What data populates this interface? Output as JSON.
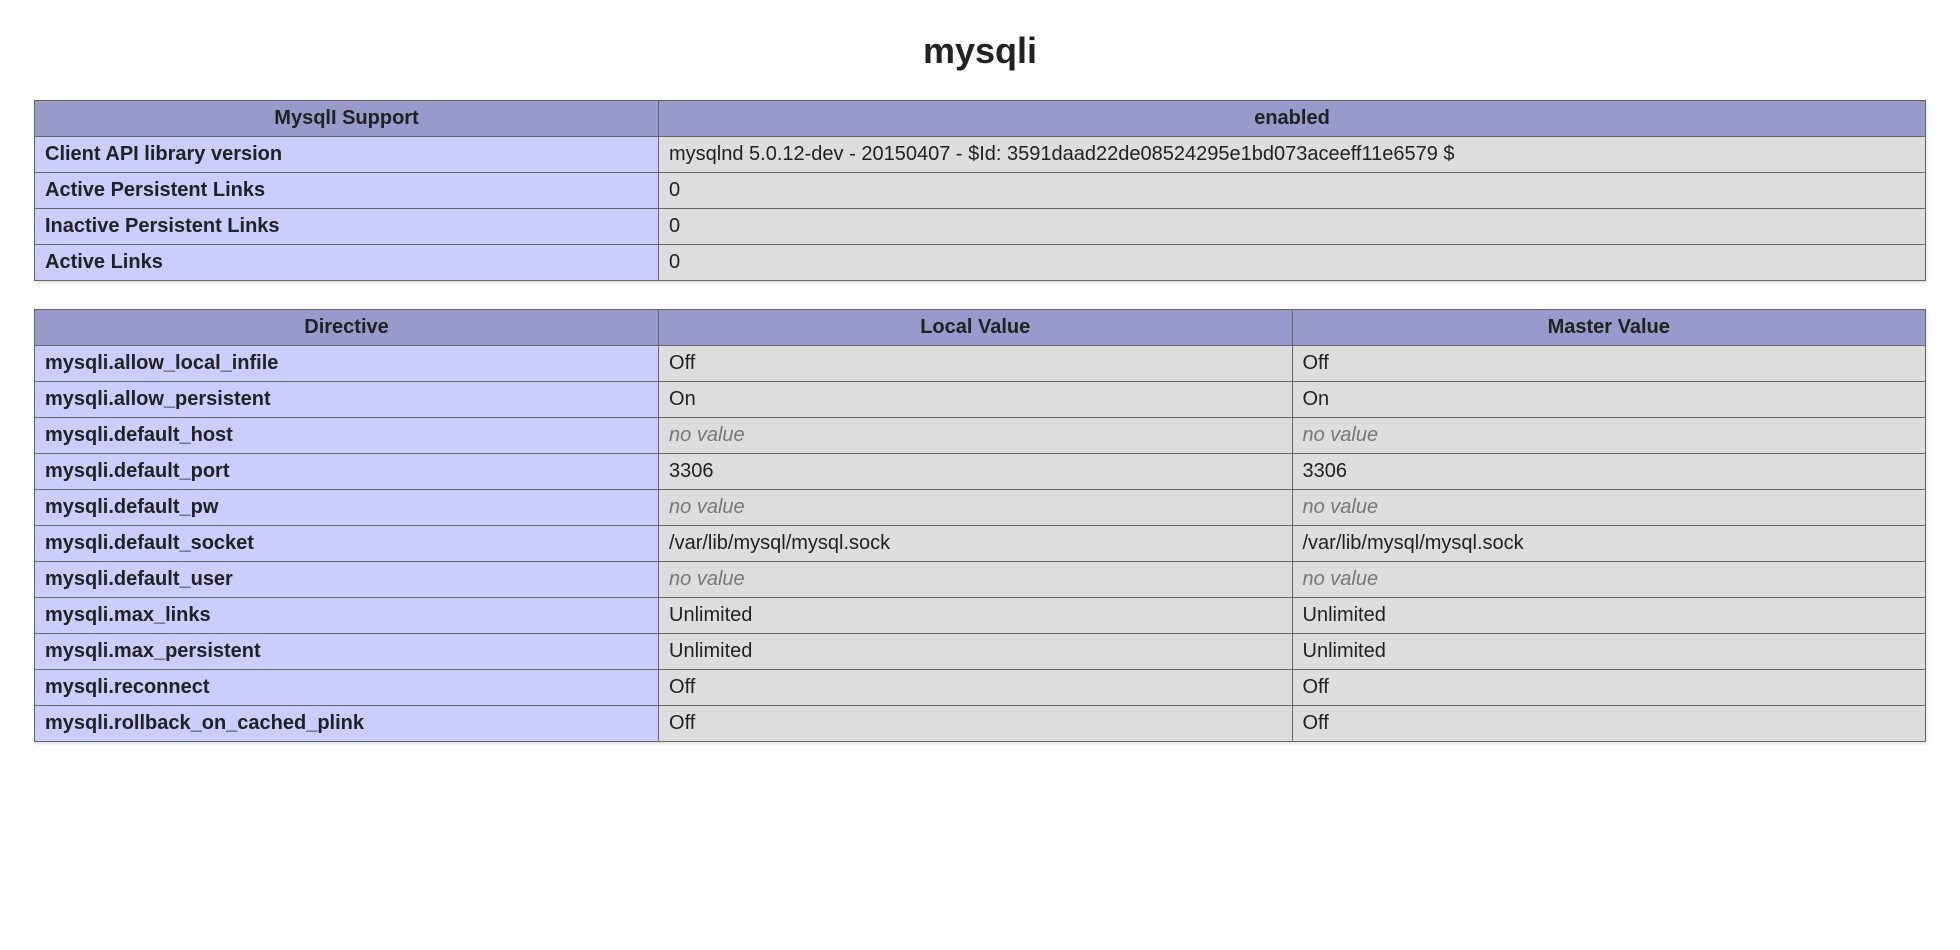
{
  "title": "mysqli",
  "summary": {
    "headers": [
      "MysqlI Support",
      "enabled"
    ],
    "rows": [
      {
        "name": "Client API library version",
        "value": "mysqlnd 5.0.12-dev - 20150407 - $Id: 3591daad22de08524295e1bd073aceeff11e6579 $"
      },
      {
        "name": "Active Persistent Links",
        "value": "0"
      },
      {
        "name": "Inactive Persistent Links",
        "value": "0"
      },
      {
        "name": "Active Links",
        "value": "0"
      }
    ]
  },
  "directives": {
    "headers": [
      "Directive",
      "Local Value",
      "Master Value"
    ],
    "no_value_text": "no value",
    "rows": [
      {
        "name": "mysqli.allow_local_infile",
        "local": "Off",
        "master": "Off"
      },
      {
        "name": "mysqli.allow_persistent",
        "local": "On",
        "master": "On"
      },
      {
        "name": "mysqli.default_host",
        "local": null,
        "master": null
      },
      {
        "name": "mysqli.default_port",
        "local": "3306",
        "master": "3306"
      },
      {
        "name": "mysqli.default_pw",
        "local": null,
        "master": null
      },
      {
        "name": "mysqli.default_socket",
        "local": "/var/lib/mysql/mysql.sock",
        "master": "/var/lib/mysql/mysql.sock"
      },
      {
        "name": "mysqli.default_user",
        "local": null,
        "master": null
      },
      {
        "name": "mysqli.max_links",
        "local": "Unlimited",
        "master": "Unlimited"
      },
      {
        "name": "mysqli.max_persistent",
        "local": "Unlimited",
        "master": "Unlimited"
      },
      {
        "name": "mysqli.reconnect",
        "local": "Off",
        "master": "Off"
      },
      {
        "name": "mysqli.rollback_on_cached_plink",
        "local": "Off",
        "master": "Off"
      }
    ]
  }
}
